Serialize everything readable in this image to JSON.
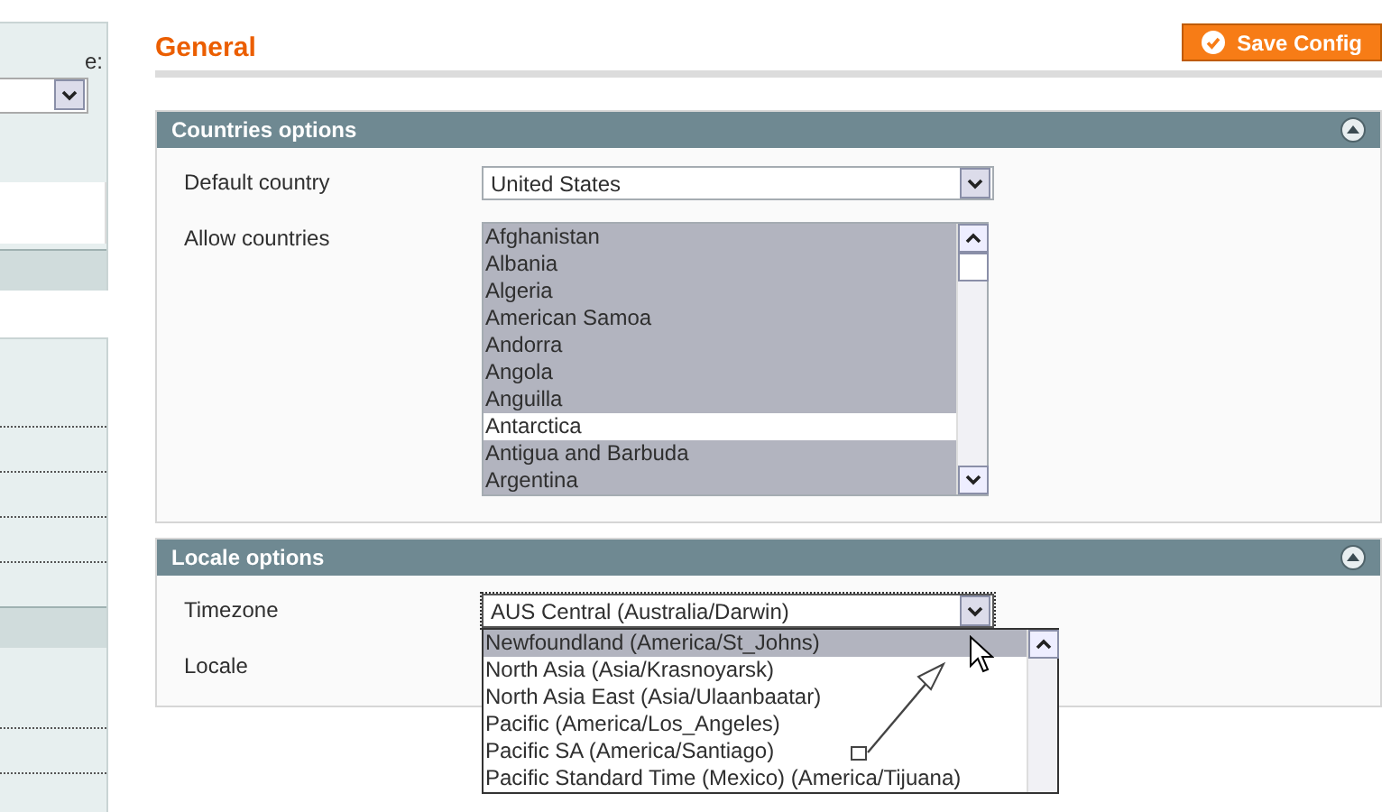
{
  "sidebar": {
    "scope_label": "e:"
  },
  "header": {
    "title": "General",
    "save_button": "Save Config"
  },
  "sections": [
    {
      "title": "Countries options",
      "expanded": true,
      "fields": [
        {
          "kind": "select",
          "label": "Default country",
          "value": "United States"
        },
        {
          "kind": "multiselect",
          "label": "Allow countries",
          "options": [
            {
              "label": "Afghanistan",
              "selected": true
            },
            {
              "label": "Albania",
              "selected": true
            },
            {
              "label": "Algeria",
              "selected": true
            },
            {
              "label": "American Samoa",
              "selected": true
            },
            {
              "label": "Andorra",
              "selected": true
            },
            {
              "label": "Angola",
              "selected": true
            },
            {
              "label": "Anguilla",
              "selected": true
            },
            {
              "label": "Antarctica",
              "selected": false
            },
            {
              "label": "Antigua and Barbuda",
              "selected": true
            },
            {
              "label": "Argentina",
              "selected": true
            }
          ]
        }
      ]
    },
    {
      "title": "Locale options",
      "expanded": true,
      "fields": [
        {
          "kind": "select",
          "label": "Timezone",
          "value": "AUS Central (Australia/Darwin)",
          "open": true,
          "options": [
            {
              "label": "Newfoundland (America/St_Johns)",
              "selected": true
            },
            {
              "label": "North Asia (Asia/Krasnoyarsk)",
              "selected": false
            },
            {
              "label": "North Asia East (Asia/Ulaanbaatar)",
              "selected": false
            },
            {
              "label": "Pacific (America/Los_Angeles)",
              "selected": false
            },
            {
              "label": "Pacific SA (America/Santiago)",
              "selected": false
            },
            {
              "label": "Pacific Standard Time (Mexico) (America/Tijuana)",
              "selected": false
            }
          ]
        },
        {
          "kind": "select",
          "label": "Locale"
        }
      ]
    }
  ]
}
